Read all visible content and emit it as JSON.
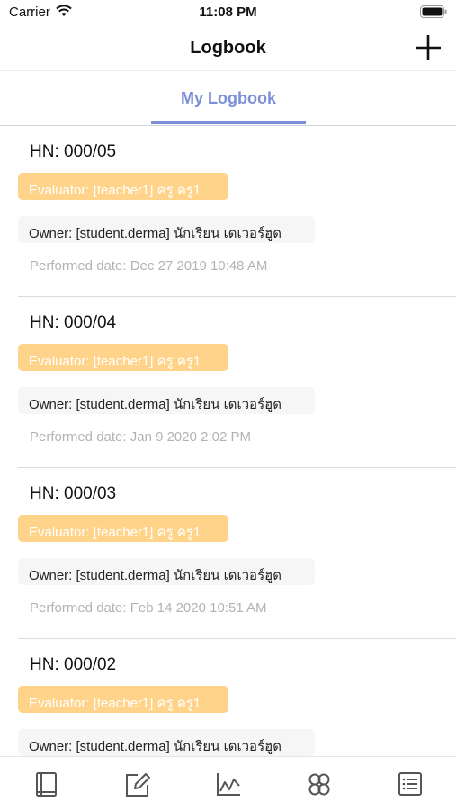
{
  "status_bar": {
    "carrier": "Carrier",
    "time": "11:08 PM"
  },
  "nav": {
    "title": "Logbook"
  },
  "tabs": [
    {
      "label": "My Logbook",
      "active": true
    }
  ],
  "entries": [
    {
      "hn": "HN: 000/05",
      "evaluator": "Evaluator: [teacher1] ครู ครู1",
      "owner": "Owner: [student.derma] นักเรียน เดเวอร์ฮูด",
      "performed": "Performed date: Dec 27 2019 10:48 AM"
    },
    {
      "hn": "HN: 000/04",
      "evaluator": "Evaluator: [teacher1] ครู ครู1",
      "owner": "Owner: [student.derma] นักเรียน เดเวอร์ฮูด",
      "performed": "Performed date: Jan 9 2020 2:02 PM"
    },
    {
      "hn": "HN: 000/03",
      "evaluator": "Evaluator: [teacher1] ครู ครู1",
      "owner": "Owner: [student.derma] นักเรียน เดเวอร์ฮูด",
      "performed": "Performed date: Feb 14 2020 10:51 AM"
    },
    {
      "hn": "HN: 000/02",
      "evaluator": "Evaluator: [teacher1] ครู ครู1",
      "owner": "Owner: [student.derma] นักเรียน เดเวอร์ฮูด",
      "performed": ""
    }
  ],
  "bottom_tabs": [
    {
      "icon": "book-icon"
    },
    {
      "icon": "edit-icon"
    },
    {
      "icon": "chart-icon"
    },
    {
      "icon": "group-icon"
    },
    {
      "icon": "list-icon"
    }
  ],
  "colors": {
    "accent": "#7b8fd6",
    "evaluator_badge": "#ffd48a",
    "owner_badge": "#f6f6f6",
    "muted_text": "#b3b3b3"
  }
}
